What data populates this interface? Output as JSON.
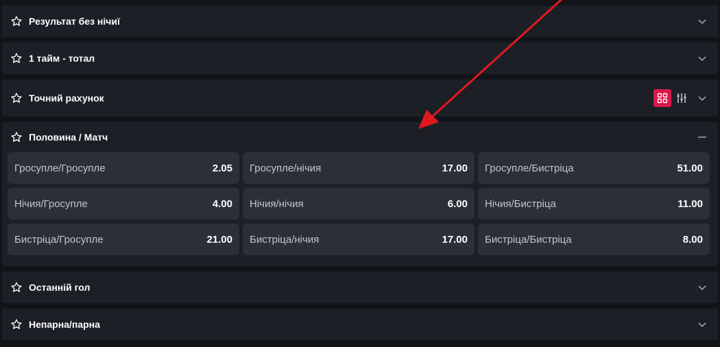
{
  "markets": [
    {
      "title": "Результат без нічиї",
      "state": "collapsed"
    },
    {
      "title": "1 тайм - тотал",
      "state": "collapsed"
    },
    {
      "title": "Точний рахунок",
      "state": "collapsed"
    },
    {
      "title": "Половина / Матч",
      "state": "expanded"
    },
    {
      "title": "Останній гол",
      "state": "collapsed"
    },
    {
      "title": "Непарна/парна",
      "state": "collapsed"
    }
  ],
  "half_match_odds": [
    {
      "label": "Гросупле/Гросупле",
      "value": "2.05"
    },
    {
      "label": "Гросупле/нічия",
      "value": "17.00"
    },
    {
      "label": "Гросупле/Бистріца",
      "value": "51.00"
    },
    {
      "label": "Нічия/Гросупле",
      "value": "4.00"
    },
    {
      "label": "Нічия/нічия",
      "value": "6.00"
    },
    {
      "label": "Нічия/Бистріца",
      "value": "11.00"
    },
    {
      "label": "Бистріца/Гросупле",
      "value": "21.00"
    },
    {
      "label": "Бистріца/нічия",
      "value": "17.00"
    },
    {
      "label": "Бистріца/Бистріца",
      "value": "8.00"
    }
  ],
  "colors": {
    "page_bg": "#12141a",
    "card_bg": "#1c1f26",
    "cell_bg": "#2c2f38",
    "accent": "#d8184b",
    "annotation_arrow": "#e0191e"
  },
  "icons": {
    "favorite": "star-outline-icon",
    "expand": "chevron-down-icon",
    "collapse": "minus-icon",
    "grid_view": "grid-view-icon",
    "list_view": "sliders-icon"
  }
}
